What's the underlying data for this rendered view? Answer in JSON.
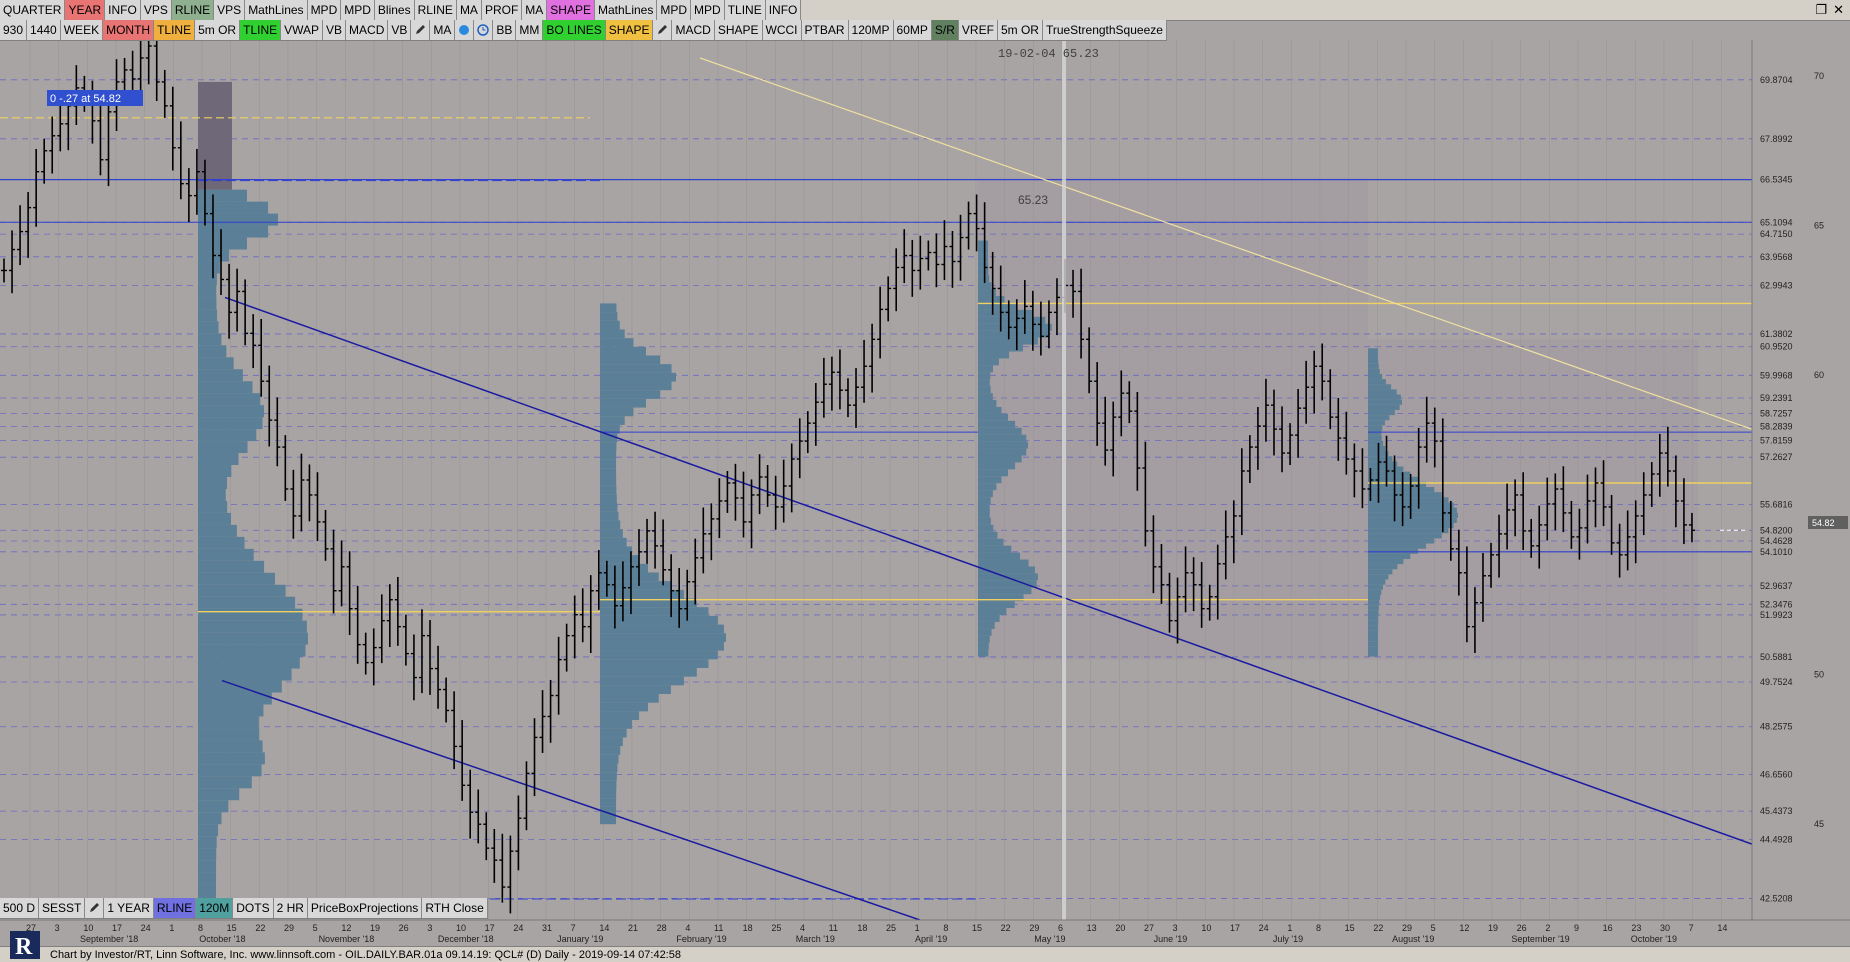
{
  "toolbar_top": [
    {
      "label": "QUARTER",
      "bg": "#d8d8d8"
    },
    {
      "label": "YEAR",
      "bg": "#e87474"
    },
    {
      "label": "INFO",
      "bg": "#d8d8d8"
    },
    {
      "label": "VPS",
      "bg": "#d8d8d8"
    },
    {
      "label": "RLINE",
      "bg": "#8fb08f"
    },
    {
      "label": "VPS",
      "bg": "#d8d8d8"
    },
    {
      "label": "MathLines",
      "bg": "#d8d8d8"
    },
    {
      "label": "MPD",
      "bg": "#d8d8d8"
    },
    {
      "label": "MPD",
      "bg": "#d8d8d8"
    },
    {
      "label": "Blines",
      "bg": "#d8d8d8"
    },
    {
      "label": "RLINE",
      "bg": "#d8d8d8"
    },
    {
      "label": "MA",
      "bg": "#d8d8d8"
    },
    {
      "label": "PROF",
      "bg": "#d8d8d8"
    },
    {
      "label": "MA",
      "bg": "#d8d8d8"
    },
    {
      "label": "SHAPE",
      "bg": "#e070e0"
    },
    {
      "label": "MathLines",
      "bg": "#d8d8d8"
    },
    {
      "label": "MPD",
      "bg": "#d8d8d8"
    },
    {
      "label": "MPD",
      "bg": "#d8d8d8"
    },
    {
      "label": "TLINE",
      "bg": "#d8d8d8"
    },
    {
      "label": "INFO",
      "bg": "#d8d8d8"
    }
  ],
  "toolbar_second": [
    {
      "label": "930",
      "bg": "#d8d8d8"
    },
    {
      "label": "1440",
      "bg": "#d8d8d8"
    },
    {
      "label": "WEEK",
      "bg": "#d8d8d8"
    },
    {
      "label": "MONTH",
      "bg": "#e87474"
    },
    {
      "label": "TLINE",
      "bg": "#f0b040"
    },
    {
      "label": "5m OR",
      "bg": "#d8d8d8"
    },
    {
      "label": "TLINE",
      "bg": "#30d030"
    },
    {
      "label": "VWAP",
      "bg": "#d8d8d8"
    },
    {
      "label": "VB",
      "bg": "#d8d8d8"
    },
    {
      "label": "MACD",
      "bg": "#d8d8d8"
    },
    {
      "label": "VB",
      "bg": "#d8d8d8"
    },
    {
      "icon": "pencil-icon"
    },
    {
      "label": "MA",
      "bg": "#d8d8d8"
    },
    {
      "icon": "drop-icon"
    },
    {
      "icon": "clock-icon"
    },
    {
      "label": "BB",
      "bg": "#d8d8d8"
    },
    {
      "label": "MM",
      "bg": "#d8d8d8"
    },
    {
      "label": "BO LINES",
      "bg": "#30d030"
    },
    {
      "label": "SHAPE",
      "bg": "#f0c040"
    },
    {
      "icon": "pencil-icon"
    },
    {
      "label": "MACD",
      "bg": "#d8d8d8"
    },
    {
      "label": "SHAPE",
      "bg": "#d8d8d8"
    },
    {
      "label": "WCCI",
      "bg": "#d8d8d8"
    },
    {
      "label": "PTBAR",
      "bg": "#d8d8d8"
    },
    {
      "label": "120MP",
      "bg": "#d8d8d8"
    },
    {
      "label": "60MP",
      "bg": "#d8d8d8"
    },
    {
      "label": "S/R",
      "bg": "#608060"
    },
    {
      "label": "VREF",
      "bg": "#d8d8d8"
    },
    {
      "label": "5m OR",
      "bg": "#d8d8d8"
    },
    {
      "label": "TrueStrengthSqueeze",
      "bg": "#d8d8d8"
    }
  ],
  "toolbar_bottom": [
    {
      "label": "500 D",
      "bg": "#d8d8d8"
    },
    {
      "label": "SESST",
      "bg": "#d8d8d8"
    },
    {
      "icon": "pencil-icon"
    },
    {
      "label": "1 YEAR",
      "bg": "#d8d8d8"
    },
    {
      "label": "RLINE",
      "bg": "#7070e0"
    },
    {
      "label": "120M",
      "bg": "#50a0a0"
    },
    {
      "label": "DOTS",
      "bg": "#d8d8d8"
    },
    {
      "label": "2 HR",
      "bg": "#d8d8d8"
    },
    {
      "label": "PriceBoxProjections",
      "bg": "#d8d8d8"
    },
    {
      "label": "RTH Close",
      "bg": "#d8d8d8"
    }
  ],
  "window_controls": {
    "restore": "❐",
    "close": "✕"
  },
  "crosshair_label": "19-02-04  65.23",
  "poc_label": "65.23",
  "box_label": "0  -.27 at 54.82",
  "last_price": "54.82",
  "status_text": "Chart by Investor/RT, Linn Software, Inc. www.linnsoft.com - OIL.DAILY.BAR.01a   09.14.19: QCL# (D) Daily - 2019-09-14 07:42:58",
  "colors": {
    "bg": "#a9a4a4",
    "bar": "#000000",
    "profile_blue": "#5b7f96",
    "profile_gray": "#6e6878",
    "hline": "#4040c0",
    "yellow": "#f0d060",
    "trend": "#2020a0"
  },
  "chart_data": {
    "type": "ohlc",
    "instrument": "QCL#",
    "timeframe": "Daily",
    "ylim": [
      41.8,
      71.2
    ],
    "price_axis_ticks": [
      "70",
      "65",
      "60",
      "55",
      "50",
      "45"
    ],
    "price_levels": [
      "69.8704",
      "67.8992",
      "66.5345",
      "65.1094",
      "64.7150",
      "63.9568",
      "62.9943",
      "61.3802",
      "60.9520",
      "59.9968",
      "59.2391",
      "58.7257",
      "58.2839",
      "57.8159",
      "57.2627",
      "55.6816",
      "54.8200",
      "54.4628",
      "54.1010",
      "52.9637",
      "52.3476",
      "51.9923",
      "50.5881",
      "49.7524",
      "48.2575",
      "46.6560",
      "45.4373",
      "44.4928",
      "42.5208"
    ],
    "date_ticks": [
      "27",
      "3",
      "10",
      "17",
      "24",
      "1",
      "8",
      "15",
      "22",
      "29",
      "5",
      "12",
      "19",
      "26",
      "3",
      "10",
      "17",
      "24",
      "31",
      "7",
      "14",
      "21",
      "28",
      "4",
      "11",
      "18",
      "25",
      "4",
      "11",
      "18",
      "25",
      "1",
      "8",
      "15",
      "22",
      "29",
      "6",
      "13",
      "20",
      "27",
      "3",
      "10",
      "17",
      "24",
      "1",
      "8",
      "15",
      "22",
      "29",
      "5",
      "12",
      "19",
      "26",
      "2",
      "9",
      "16",
      "23",
      "30",
      "7",
      "14"
    ],
    "month_labels": [
      "September '18",
      "October '18",
      "November '18",
      "December '18",
      "January '19",
      "February '19",
      "March '19",
      "April '19",
      "May '19",
      "June '19",
      "July '19",
      "August '19",
      "September '19",
      "October '19"
    ],
    "closes": [
      63.5,
      64.2,
      64.8,
      65.6,
      66.8,
      67.5,
      68.0,
      68.4,
      69.0,
      69.6,
      69.2,
      68.5,
      67.2,
      68.8,
      69.8,
      70.2,
      69.9,
      70.6,
      71.0,
      69.8,
      69.0,
      67.6,
      66.4,
      66.0,
      66.8,
      65.4,
      64.0,
      63.2,
      62.1,
      62.8,
      61.4,
      61.0,
      59.8,
      58.5,
      57.6,
      56.2,
      55.3,
      56.5,
      56.0,
      55.1,
      54.2,
      52.8,
      53.6,
      52.2,
      51.0,
      50.4,
      50.9,
      51.8,
      52.5,
      51.6,
      50.7,
      49.9,
      51.3,
      50.2,
      49.5,
      48.8,
      47.6,
      46.3,
      45.4,
      45.0,
      44.2,
      43.8,
      42.9,
      44.1,
      45.2,
      46.7,
      47.9,
      48.6,
      49.3,
      50.5,
      51.3,
      52.0,
      51.6,
      52.8,
      53.4,
      53.0,
      52.3,
      52.9,
      53.6,
      54.1,
      54.8,
      54.3,
      53.5,
      52.8,
      52.2,
      53.1,
      53.9,
      54.7,
      55.2,
      55.8,
      56.4,
      55.9,
      55.1,
      56.0,
      56.6,
      56.0,
      55.6,
      56.3,
      57.2,
      57.8,
      58.4,
      59.1,
      59.7,
      60.1,
      59.5,
      59.0,
      59.6,
      60.3,
      61.2,
      62.2,
      62.9,
      63.6,
      64.0,
      63.5,
      63.9,
      64.1,
      63.7,
      64.3,
      63.8,
      64.6,
      65.4,
      64.9,
      63.6,
      62.9,
      62.1,
      61.6,
      61.9,
      62.3,
      61.7,
      61.3,
      62.1,
      62.6,
      63.0,
      62.8,
      61.2,
      59.8,
      58.4,
      57.5,
      58.6,
      59.4,
      58.8,
      56.9,
      54.8,
      53.6,
      53.0,
      51.8,
      52.6,
      53.4,
      53.0,
      52.2,
      52.6,
      53.7,
      54.6,
      55.3,
      56.8,
      57.6,
      58.3,
      59.0,
      58.2,
      57.4,
      58.0,
      58.9,
      59.6,
      60.3,
      59.8,
      58.6,
      57.9,
      57.2,
      56.8,
      56.2,
      56.5,
      57.1,
      56.8,
      56.0,
      55.6,
      56.3,
      57.6,
      58.4,
      57.8,
      55.4,
      54.2,
      53.4,
      51.6,
      52.4,
      53.3,
      54.0,
      54.7,
      55.5,
      56.0,
      54.8,
      54.3,
      55.0,
      55.7,
      56.2,
      55.4,
      54.6,
      54.9,
      55.8,
      56.4,
      55.6,
      54.4,
      54.0,
      54.6,
      55.3,
      56.0,
      56.7,
      57.4,
      56.8,
      55.8,
      55.0,
      54.82
    ]
  }
}
